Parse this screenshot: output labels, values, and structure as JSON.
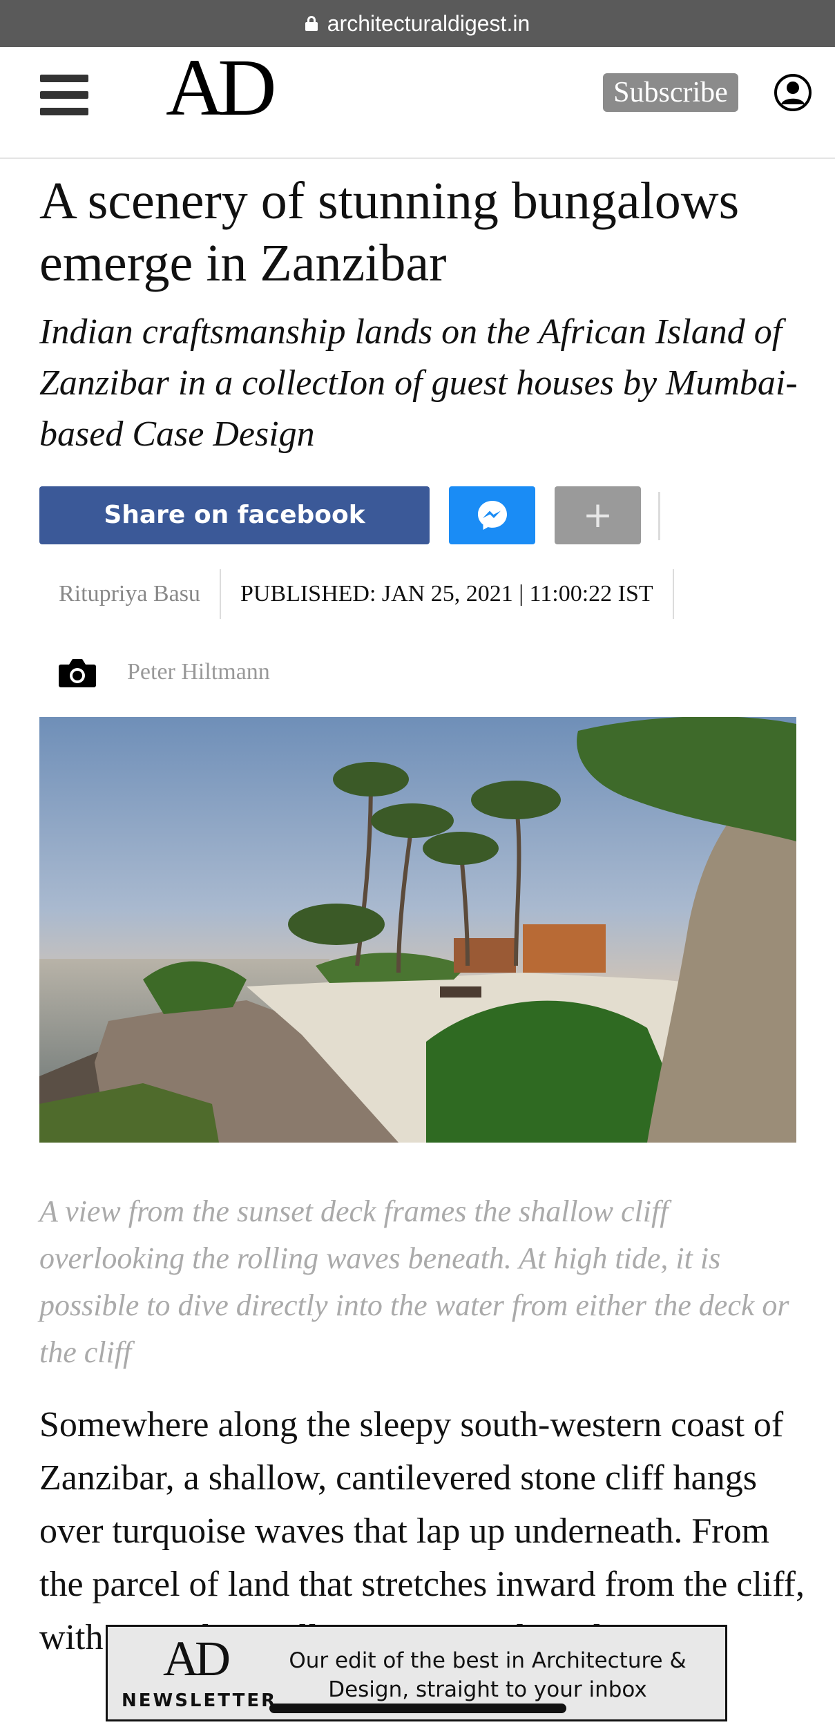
{
  "browser": {
    "url": "architecturaldigest.in"
  },
  "header": {
    "logo": "AD",
    "subscribe_label": "Subscribe"
  },
  "article": {
    "title": "A scenery of stunning bungalows emerge in Zanzibar",
    "subtitle": "Indian craftsmanship lands on the African Island of Zanzibar in a collectIon of guest houses by Mumbai-based Case Design",
    "share": {
      "facebook_label": "Share on facebook",
      "more_label": "+"
    },
    "author": "Ritupriya Basu",
    "published": "PUBLISHED: JAN 25, 2021 | 11:00:22 IST",
    "photographer": "Peter Hiltmann",
    "caption": "A view from the sunset deck frames the shallow cliff overlooking the rolling waves beneath. At high tide, it is possible to dive directly into the water from either the deck or the cliff",
    "body": "Somewhere along the sleepy south-western coast of Zanzibar, a shallow, cantilevered stone cliff hangs over turquoise waves that lap up underneath. From the parcel of land that stretches inward from the cliff, with Kizimkazi village on one side and a quaint"
  },
  "newsletter": {
    "logo": "AD",
    "label": "NEWSLETTER",
    "text": "Our edit of the best in Architecture & Design, straight to your inbox"
  },
  "colors": {
    "facebook": "#3b5998",
    "messenger": "#1a8cf5",
    "subscribe": "#8b8b8b"
  }
}
